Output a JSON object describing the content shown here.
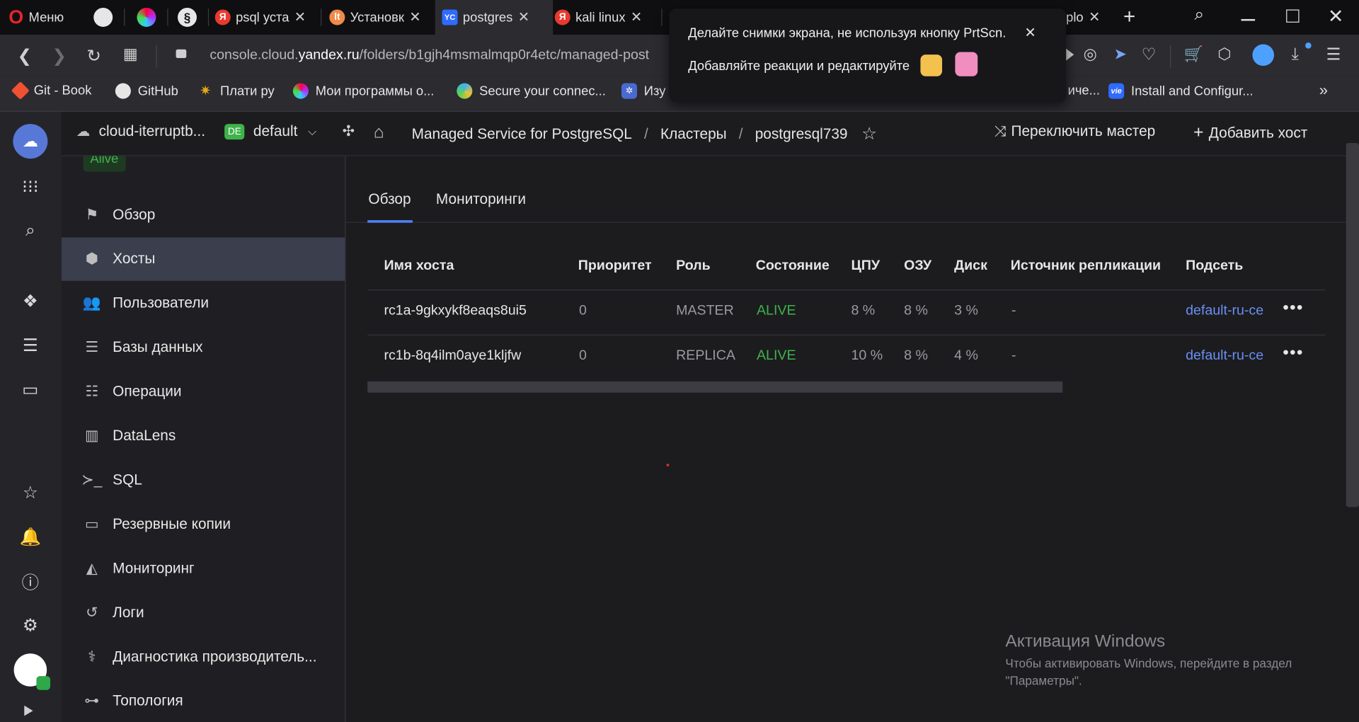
{
  "browser": {
    "menu_label": "Меню",
    "tabs": [
      {
        "label": "psql уста",
        "icon": "yandex-icon",
        "color": "#e83a2f"
      },
      {
        "label": "Установк",
        "icon": "lt-icon",
        "color": "#f08a4b"
      },
      {
        "label": "postgres",
        "icon": "yc-icon",
        "color": "#2f6bff",
        "active": true
      },
      {
        "label": "kali linux",
        "icon": "yandex-icon",
        "color": "#e83a2f"
      },
      {
        "label": "plo",
        "icon": "page-icon",
        "color": "#555"
      }
    ],
    "url": {
      "prefix": "console.cloud.",
      "domain": "yandex.ru",
      "path": "/folders/b1gjh4msmalmqp0r4etc/managed-post"
    },
    "bookmarks": [
      {
        "label": "Git - Book",
        "icon": "git-icon",
        "color": "#f05133"
      },
      {
        "label": "GitHub",
        "icon": "github-icon",
        "color": "#333"
      },
      {
        "label": "Плати ру",
        "icon": "star-burst-icon",
        "color": "#e6a817"
      },
      {
        "label": "Мои программы о...",
        "icon": "app-icon",
        "color": "#a13cf0"
      },
      {
        "label": "Secure your connec...",
        "icon": "globe-icon",
        "color": "#3cb4f0"
      },
      {
        "label": "Изу",
        "icon": "cog-icon",
        "color": "#4a6ad0"
      },
      {
        "label": "иче...",
        "icon": "page-icon",
        "color": "#555"
      },
      {
        "label": "Install and Configur...",
        "icon": "vie-icon",
        "color": "#2f6bff"
      }
    ],
    "popup": {
      "line1": "Делайте снимки экрана, не используя кнопку PrtScn.",
      "line2": "Добавляйте реакции и редактируйте"
    }
  },
  "header": {
    "cloud": "cloud-iterruptb...",
    "folder_badge": "DE",
    "folder": "default",
    "breadcrumbs": [
      "Managed Service for PostgreSQL",
      "Кластеры",
      "postgresql739"
    ],
    "switch_master": "Переключить мастер",
    "add_host": "Добавить хост"
  },
  "sidebar": {
    "status": "Alive",
    "items": [
      {
        "label": "Обзор",
        "icon": "flag-icon"
      },
      {
        "label": "Хосты",
        "icon": "cube-icon",
        "active": true
      },
      {
        "label": "Пользователи",
        "icon": "users-icon"
      },
      {
        "label": "Базы данных",
        "icon": "database-icon"
      },
      {
        "label": "Операции",
        "icon": "list-icon"
      },
      {
        "label": "DataLens",
        "icon": "bar-chart-icon"
      },
      {
        "label": "SQL",
        "icon": "terminal-icon"
      },
      {
        "label": "Резервные копии",
        "icon": "archive-icon"
      },
      {
        "label": "Мониторинг",
        "icon": "area-chart-icon"
      },
      {
        "label": "Логи",
        "icon": "history-icon"
      },
      {
        "label": "Диагностика производитель...",
        "icon": "diagnostics-icon"
      },
      {
        "label": "Топология",
        "icon": "topology-icon"
      }
    ]
  },
  "tabs": [
    "Обзор",
    "Мониторинги"
  ],
  "table": {
    "columns": [
      "Имя хоста",
      "Приоритет",
      "Роль",
      "Состояние",
      "ЦПУ",
      "ОЗУ",
      "Диск",
      "Источник репликации",
      "Подсеть"
    ],
    "rows": [
      {
        "host": "rc1a-9gkxykf8eaqs8ui5",
        "priority": "0",
        "role": "MASTER",
        "state": "ALIVE",
        "cpu": "8 %",
        "ram": "8 %",
        "disk": "3 %",
        "source": "-",
        "subnet": "default-ru-ce"
      },
      {
        "host": "rc1b-8q4ilm0aye1kljfw",
        "priority": "0",
        "role": "REPLICA",
        "state": "ALIVE",
        "cpu": "10 %",
        "ram": "8 %",
        "disk": "4 %",
        "source": "-",
        "subnet": "default-ru-ce"
      }
    ]
  },
  "watermark": {
    "title": "Активация Windows",
    "text1": "Чтобы активировать Windows, перейдите в раздел",
    "text2": "\"Параметры\"."
  }
}
